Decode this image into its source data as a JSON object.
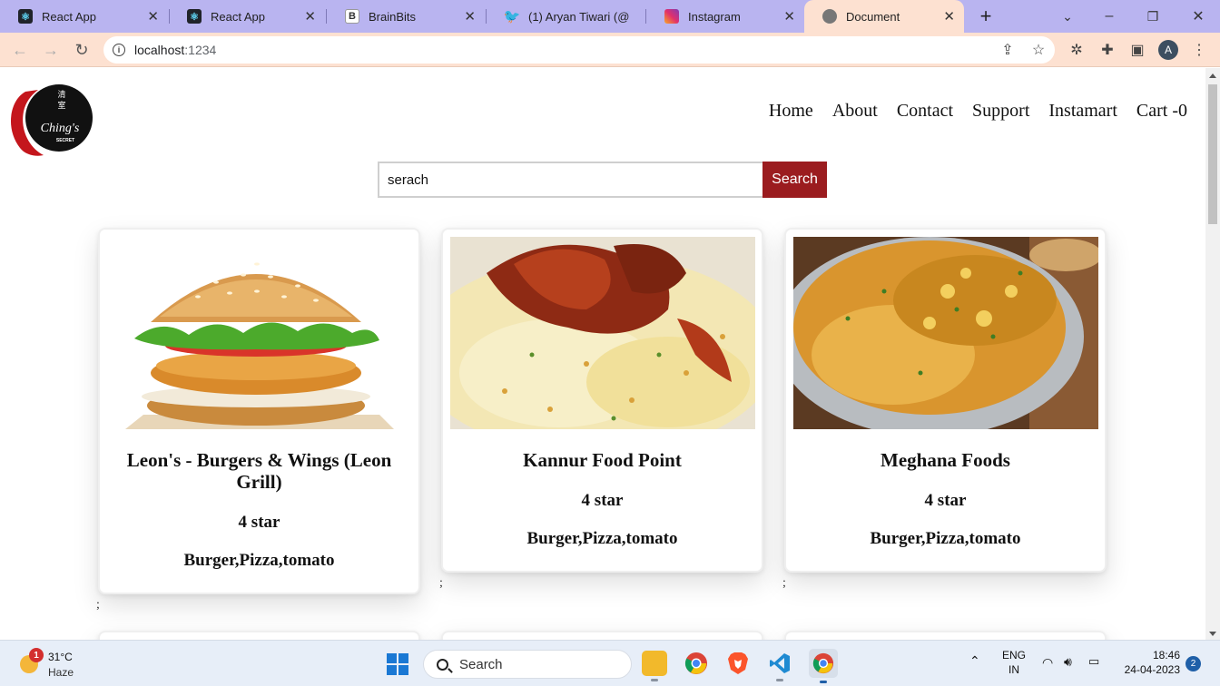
{
  "browser": {
    "tabs": [
      {
        "title": "React App",
        "icon": "react-icon",
        "active": false
      },
      {
        "title": "React App",
        "icon": "react-icon",
        "active": false
      },
      {
        "title": "BrainBits",
        "icon": "brainbits-icon",
        "active": false
      },
      {
        "title": "(1) Aryan Tiwari (@",
        "icon": "twitter-icon",
        "active": false
      },
      {
        "title": "Instagram",
        "icon": "instagram-icon",
        "active": false
      },
      {
        "title": "Document",
        "icon": "globe-icon",
        "active": true
      }
    ],
    "address": "localhost",
    "address_port": ":1234",
    "profile_initial": "A"
  },
  "page": {
    "logo_text": "Ching's",
    "logo_subtext": "SECRET",
    "nav": [
      "Home",
      "About",
      "Contact",
      "Support",
      "Instamart",
      "Cart -0"
    ],
    "search": {
      "value": "serach",
      "button": "Search"
    },
    "restaurants": [
      {
        "name": "Leon's - Burgers & Wings (Leon Grill)",
        "rating": "4 star",
        "cuisines": "Burger,Pizza,tomato",
        "image": "burger"
      },
      {
        "name": "Kannur Food Point",
        "rating": "4 star",
        "cuisines": "Burger,Pizza,tomato",
        "image": "biryani"
      },
      {
        "name": "Meghana Foods",
        "rating": "4 star",
        "cuisines": "Burger,Pizza,tomato",
        "image": "pulao"
      }
    ],
    "separator": ";"
  },
  "taskbar": {
    "weather_temp": "31°C",
    "weather_cond": "Haze",
    "weather_badge": "1",
    "search_label": "Search",
    "lang_top": "ENG",
    "lang_bottom": "IN",
    "time": "18:46",
    "date": "24-04-2023",
    "notifications": "2"
  },
  "colors": {
    "tabstrip": "#b9b4f0",
    "toolbar": "#fde1d1",
    "search_button": "#9b1c1f"
  }
}
